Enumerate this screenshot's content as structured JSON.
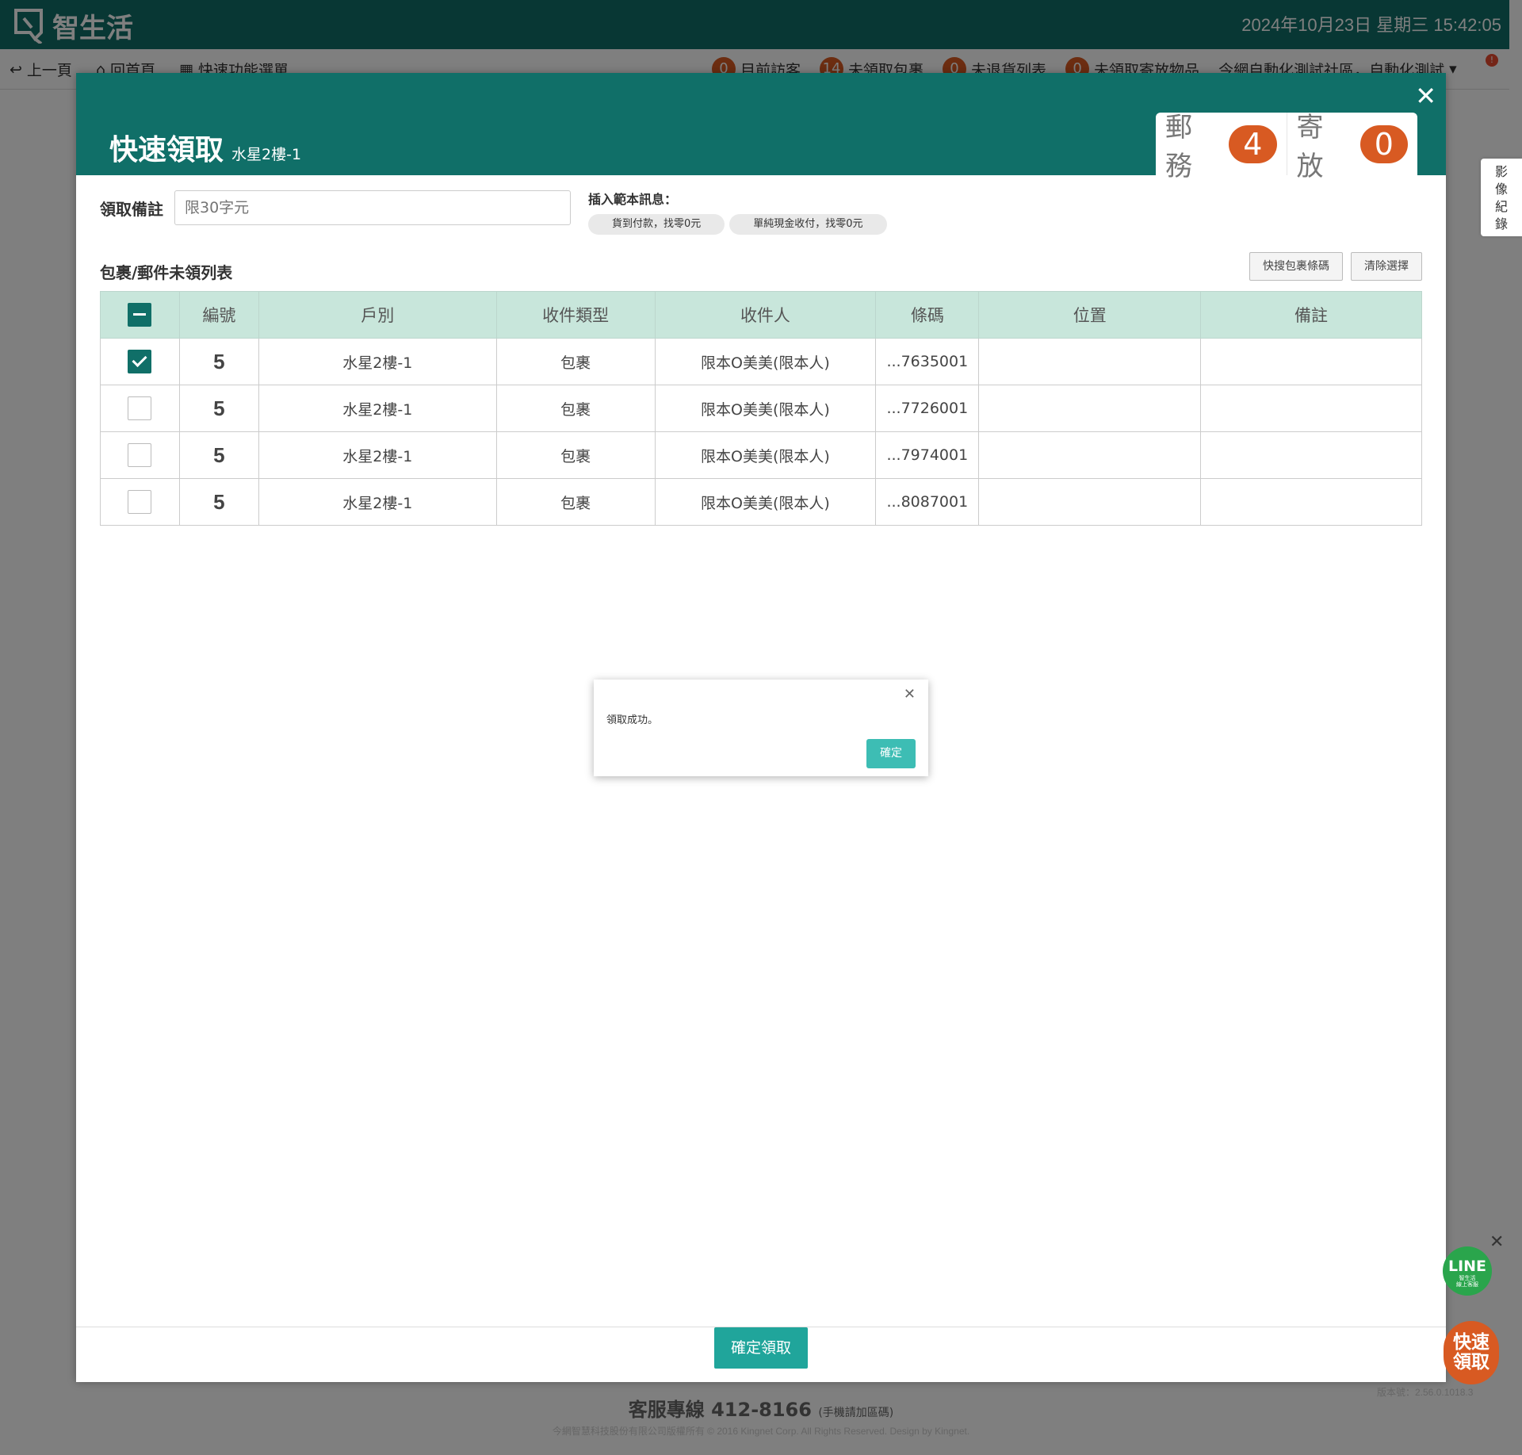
{
  "app": {
    "name": "智生活",
    "datetime": "2024年10月23日 星期三 15:42:05"
  },
  "nav": {
    "back": "上一頁",
    "home": "回首頁",
    "quick_menu": "快速功能選單",
    "stats": [
      {
        "count": "0",
        "label": "目前訪客"
      },
      {
        "count": "14",
        "label": "未領取包裹"
      },
      {
        "count": "0",
        "label": "未退貨列表"
      },
      {
        "count": "0",
        "label": "未領取寄放物品"
      }
    ],
    "community": "今網自動化測試社區，自動化測試",
    "alert": "!"
  },
  "modal": {
    "title": "快速領取",
    "subtitle": "水星2樓-1",
    "tabs": [
      {
        "label": "郵務",
        "count": "4"
      },
      {
        "label": "寄放",
        "count": "0"
      }
    ],
    "note_label": "領取備註",
    "note_placeholder": "限30字元",
    "template_label": "插入範本訊息：",
    "templates": [
      "貨到付款，找零0元",
      "單純現金收付，找零0元"
    ],
    "list_title": "包裹/郵件未領列表",
    "tool_buttons": [
      "快搜包裹條碼",
      "清除選擇"
    ],
    "columns": [
      "編號",
      "戶別",
      "收件類型",
      "收件人",
      "條碼",
      "位置",
      "備註"
    ],
    "rows": [
      {
        "checked": true,
        "no": "5",
        "unit": "水星2樓-1",
        "type": "包裹",
        "recipient": "限本O美美(限本人)",
        "barcode": "...7635001",
        "location": "",
        "note": ""
      },
      {
        "checked": false,
        "no": "5",
        "unit": "水星2樓-1",
        "type": "包裹",
        "recipient": "限本O美美(限本人)",
        "barcode": "...7726001",
        "location": "",
        "note": ""
      },
      {
        "checked": false,
        "no": "5",
        "unit": "水星2樓-1",
        "type": "包裹",
        "recipient": "限本O美美(限本人)",
        "barcode": "...7974001",
        "location": "",
        "note": ""
      },
      {
        "checked": false,
        "no": "5",
        "unit": "水星2樓-1",
        "type": "包裹",
        "recipient": "限本O美美(限本人)",
        "barcode": "...8087001",
        "location": "",
        "note": ""
      }
    ],
    "confirm": "確定領取"
  },
  "dialog": {
    "message": "領取成功。",
    "ok": "確定"
  },
  "side": {
    "video_record": [
      "影",
      "像",
      "紀",
      "錄"
    ],
    "line_label": "LINE",
    "line_sub1": "智生活",
    "line_sub2": "線上客服",
    "quick_line1": "快速",
    "quick_line2": "領取"
  },
  "footer": {
    "version": "版本號：2.56.0.1018.3",
    "hotline_label": "客服專線",
    "hotline_number": "412-8166",
    "hotline_note": "(手機請加區碼)",
    "copyright": "今網智慧科技股份有限公司版權所有 © 2016 Kingnet Corp. All Rights Reserved. Design by Kingnet."
  },
  "colors": {
    "primary": "#106f68",
    "accent": "#d85a22",
    "table_header": "#c8e6db",
    "ok_button": "#3dbdb4"
  }
}
